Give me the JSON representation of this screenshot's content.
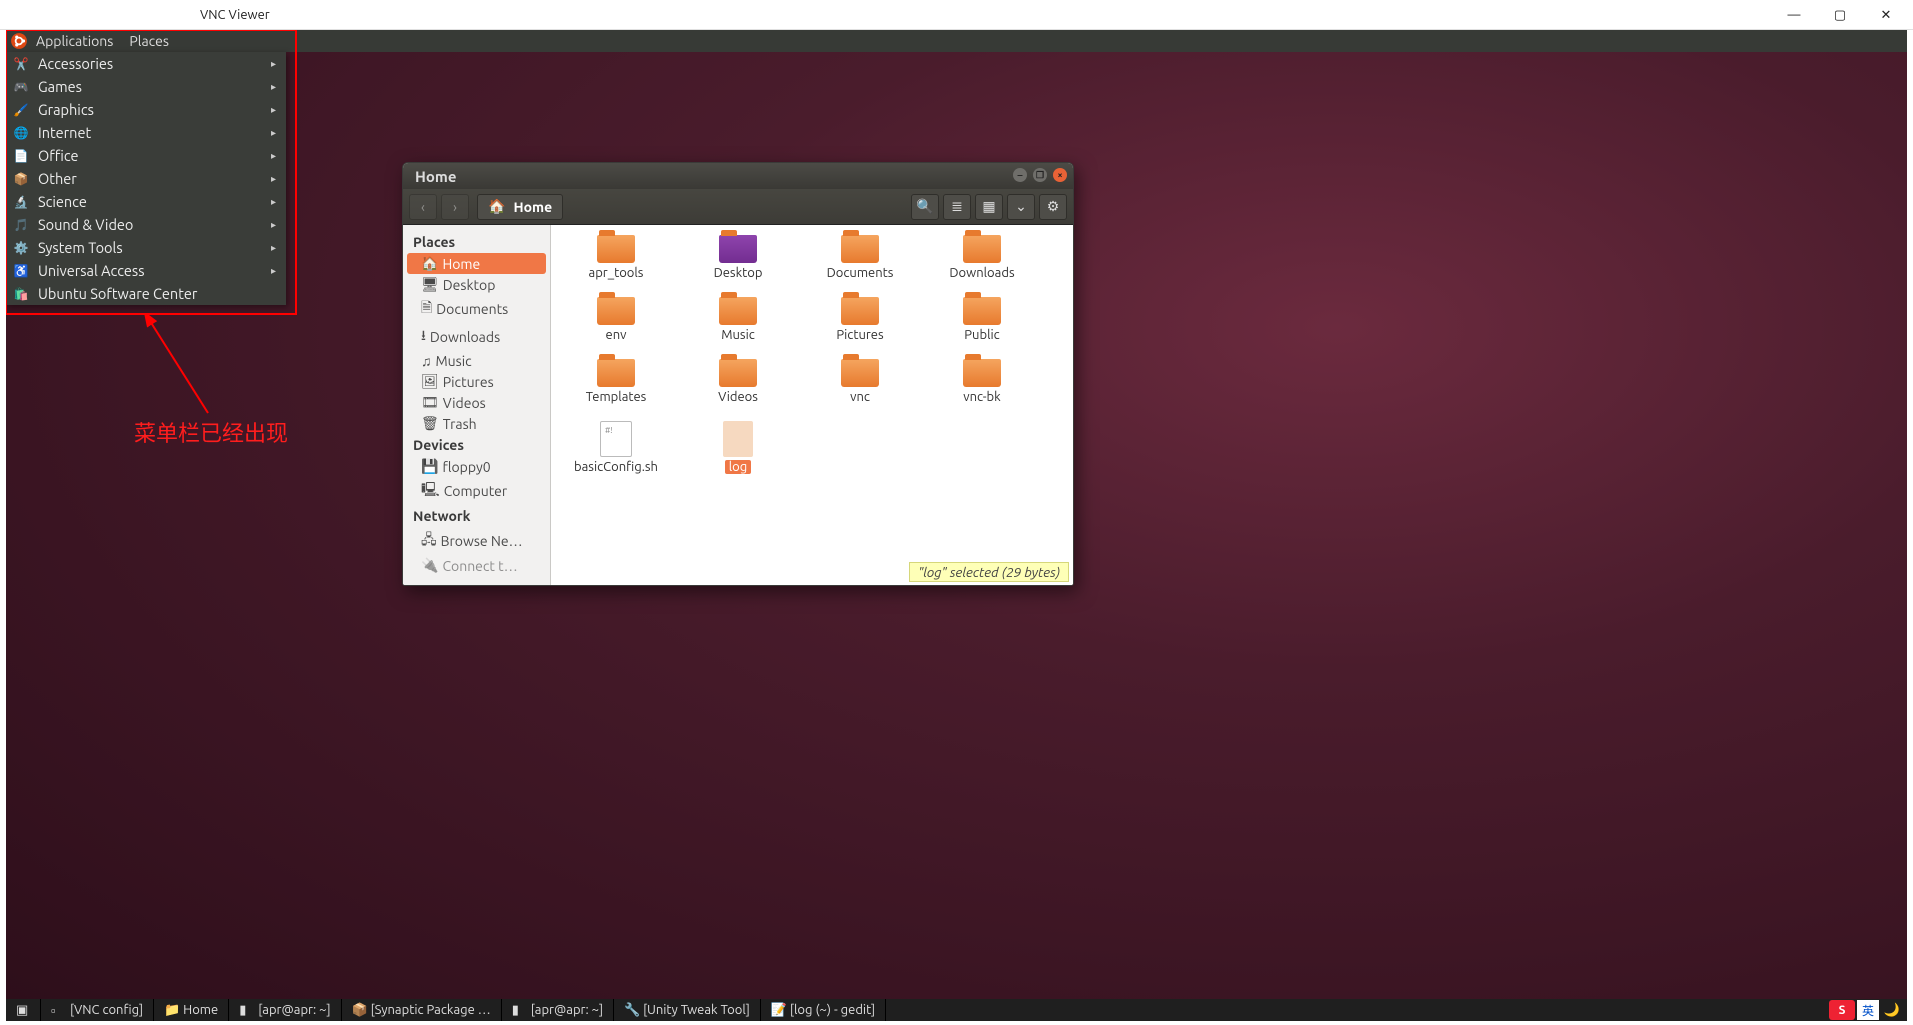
{
  "host_window": {
    "title": "VNC Viewer"
  },
  "gnome_panel": {
    "applications": "Applications",
    "places": "Places"
  },
  "app_menu": {
    "items": [
      {
        "label": "Accessories",
        "submenu": true,
        "icon": "accessories"
      },
      {
        "label": "Games",
        "submenu": true,
        "icon": "games"
      },
      {
        "label": "Graphics",
        "submenu": true,
        "icon": "graphics"
      },
      {
        "label": "Internet",
        "submenu": true,
        "icon": "internet"
      },
      {
        "label": "Office",
        "submenu": true,
        "icon": "office"
      },
      {
        "label": "Other",
        "submenu": true,
        "icon": "other"
      },
      {
        "label": "Science",
        "submenu": true,
        "icon": "science"
      },
      {
        "label": "Sound & Video",
        "submenu": true,
        "icon": "sound-video"
      },
      {
        "label": "System Tools",
        "submenu": true,
        "icon": "system-tools"
      },
      {
        "label": "Universal Access",
        "submenu": true,
        "icon": "universal-access"
      },
      {
        "label": "Ubuntu Software Center",
        "submenu": false,
        "icon": "software-center"
      }
    ]
  },
  "annotation": {
    "text": "菜单栏已经出现"
  },
  "nautilus": {
    "title": "Home",
    "path_label": "Home",
    "sidebar": {
      "places_heading": "Places",
      "places": [
        "Home",
        "Desktop",
        "Documents",
        "Downloads",
        "Music",
        "Pictures",
        "Videos",
        "Trash"
      ],
      "devices_heading": "Devices",
      "devices": [
        "floppy0",
        "Computer"
      ],
      "network_heading": "Network",
      "network": [
        "Browse Ne…",
        "Connect t…"
      ]
    },
    "items": [
      {
        "name": "apr_tools",
        "type": "folder"
      },
      {
        "name": "Desktop",
        "type": "folder-desktop"
      },
      {
        "name": "Documents",
        "type": "folder"
      },
      {
        "name": "Downloads",
        "type": "folder-downloads"
      },
      {
        "name": "env",
        "type": "folder"
      },
      {
        "name": "Music",
        "type": "folder-music"
      },
      {
        "name": "Pictures",
        "type": "folder-pictures"
      },
      {
        "name": "Public",
        "type": "folder-public"
      },
      {
        "name": "Templates",
        "type": "folder-templates"
      },
      {
        "name": "Videos",
        "type": "folder-videos"
      },
      {
        "name": "vnc",
        "type": "folder"
      },
      {
        "name": "vnc-bk",
        "type": "folder"
      },
      {
        "name": "basicConfig.sh",
        "type": "file-sh"
      },
      {
        "name": "log",
        "type": "file-log",
        "selected": true
      }
    ],
    "status": "\"log\" selected (29 bytes)"
  },
  "taskbar": {
    "tasks": [
      "[VNC config]",
      "Home",
      "[apr@apr: ~]",
      "[Synaptic Package …",
      "[apr@apr: ~]",
      "[Unity Tweak Tool]",
      "[log (~) - gedit]"
    ],
    "ime_main": "S",
    "ime_lang": "英"
  }
}
